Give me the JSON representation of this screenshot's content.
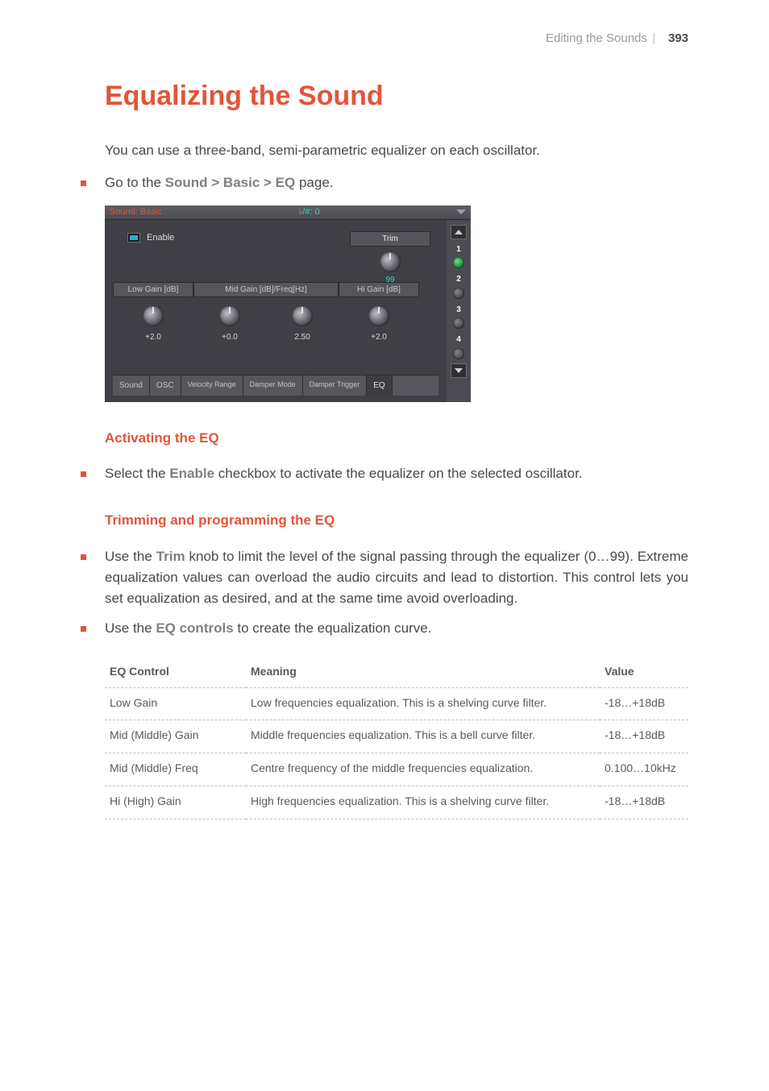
{
  "header": {
    "section": "Editing the Sounds",
    "page": "393"
  },
  "title": "Equalizing the Sound",
  "intro": "You can use a three-band, semi-parametric equalizer on each oscillator.",
  "goto": {
    "prefix": "Go to the ",
    "path": "Sound > Basic > EQ",
    "suffix": " page."
  },
  "panel": {
    "titlebar_left": "Sound: Basic",
    "titlebar_center": "♭/#: 0",
    "enable_label": "Enable",
    "trim": {
      "label": "Trim",
      "value": "99"
    },
    "cols": {
      "low": {
        "header": "Low Gain [dB]",
        "value": "+2.0"
      },
      "mid": {
        "header": "Mid Gain [dB]/Freq[Hz]",
        "gain": "+0.0",
        "freq": "2.50"
      },
      "high": {
        "header": "Hi Gain [dB]",
        "value": "+2.0"
      }
    },
    "side_slots": [
      "1",
      "2",
      "3",
      "4"
    ],
    "tabs": [
      "Sound",
      "OSC",
      "Velocity Range",
      "Damper Mode",
      "Damper Trigger",
      "EQ"
    ]
  },
  "sub1": {
    "heading": "Activating the EQ",
    "bullet_prefix": "Select the ",
    "bullet_strong": "Enable",
    "bullet_suffix": " checkbox to activate the equalizer on the selected oscillator."
  },
  "sub2": {
    "heading": "Trimming and programming the EQ",
    "b1_prefix": "Use the ",
    "b1_strong": "Trim",
    "b1_suffix": " knob to limit the level of the signal passing through the equalizer (0…99). Extreme equalization values can overload the audio circuits and lead to distortion. This control lets you set equalization as desired, and at the same time avoid overloading.",
    "b2_prefix": "Use the ",
    "b2_strong": "EQ controls",
    "b2_suffix": " to create the equalization curve."
  },
  "table": {
    "headers": {
      "c1": "EQ Control",
      "c2": "Meaning",
      "c3": "Value"
    },
    "rows": [
      {
        "c1": "Low Gain",
        "c2": "Low frequencies equalization. This is a shelving curve filter.",
        "c3": "-18…+18dB"
      },
      {
        "c1": "Mid (Middle) Gain",
        "c2": "Middle frequencies equalization. This is a bell curve filter.",
        "c3": "-18…+18dB"
      },
      {
        "c1": "Mid (Middle) Freq",
        "c2": "Centre frequency of the middle frequencies equalization.",
        "c3": "0.100…10kHz"
      },
      {
        "c1": "Hi (High) Gain",
        "c2": "High frequencies equalization. This is a shelving curve filter.",
        "c3": "-18…+18dB"
      }
    ]
  }
}
